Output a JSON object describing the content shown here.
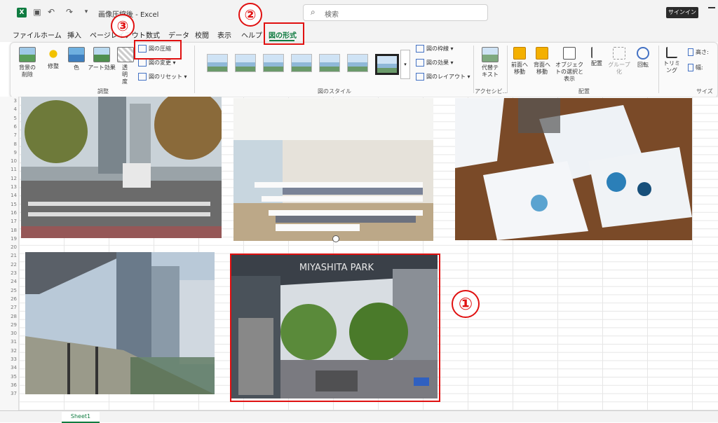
{
  "titlebar": {
    "title": "画像圧縮後 - Excel",
    "search_placeholder": "検索",
    "signin": "サインイン"
  },
  "tabs": [
    "ファイル",
    "ホーム",
    "挿入",
    "ページレイアウト",
    "数式",
    "データ",
    "校閲",
    "表示",
    "ヘルプ",
    "図の形式"
  ],
  "ribbon": {
    "adjust": {
      "remove_bg": "背景の削除",
      "corrections": "修整",
      "color": "色",
      "artistic": "アート効果",
      "transparency": "透明度",
      "compress": "図の圧縮",
      "change": "図の変更",
      "reset": "図のリセット",
      "label": "調整"
    },
    "styles": {
      "border": "図の枠線",
      "effects": "図の効果",
      "layout": "図のレイアウト",
      "label": "図のスタイル"
    },
    "accessibility": {
      "alt_text": "代替テキスト",
      "label": "アクセシビ..."
    },
    "arrange": {
      "bring_forward": "前面へ移動",
      "send_backward": "背面へ移動",
      "selection_pane": "オブジェクトの選択と表示",
      "align": "配置",
      "group": "グループ化",
      "rotate": "回転",
      "label": "配置"
    },
    "size": {
      "crop": "トリミング",
      "height": "高さ:",
      "width": "幅:",
      "label": "サイズ"
    }
  },
  "row_numbers": [
    "3",
    "4",
    "5",
    "6",
    "7",
    "8",
    "9",
    "10",
    "11",
    "12",
    "13",
    "14",
    "15",
    "16",
    "17",
    "18",
    "19",
    "20",
    "21",
    "22",
    "23",
    "24",
    "25",
    "26",
    "27",
    "28",
    "29",
    "30",
    "31",
    "32",
    "33",
    "34",
    "35",
    "36",
    "37"
  ],
  "photos": {
    "p1": "city crossing with trees",
    "p2": "empty seminar room",
    "p3": "business documents on desk",
    "p4": "covered walkway and skyscrapers",
    "p5": "MIYASHITA PARK street view"
  },
  "photo5_sign": "MIYASHITA PARK",
  "sheet_tab": "Sheet1",
  "annotations": {
    "n1": "①",
    "n2": "②",
    "n3": "③"
  },
  "colors": {
    "excel_green": "#107c41",
    "annotation_red": "#e01010"
  }
}
